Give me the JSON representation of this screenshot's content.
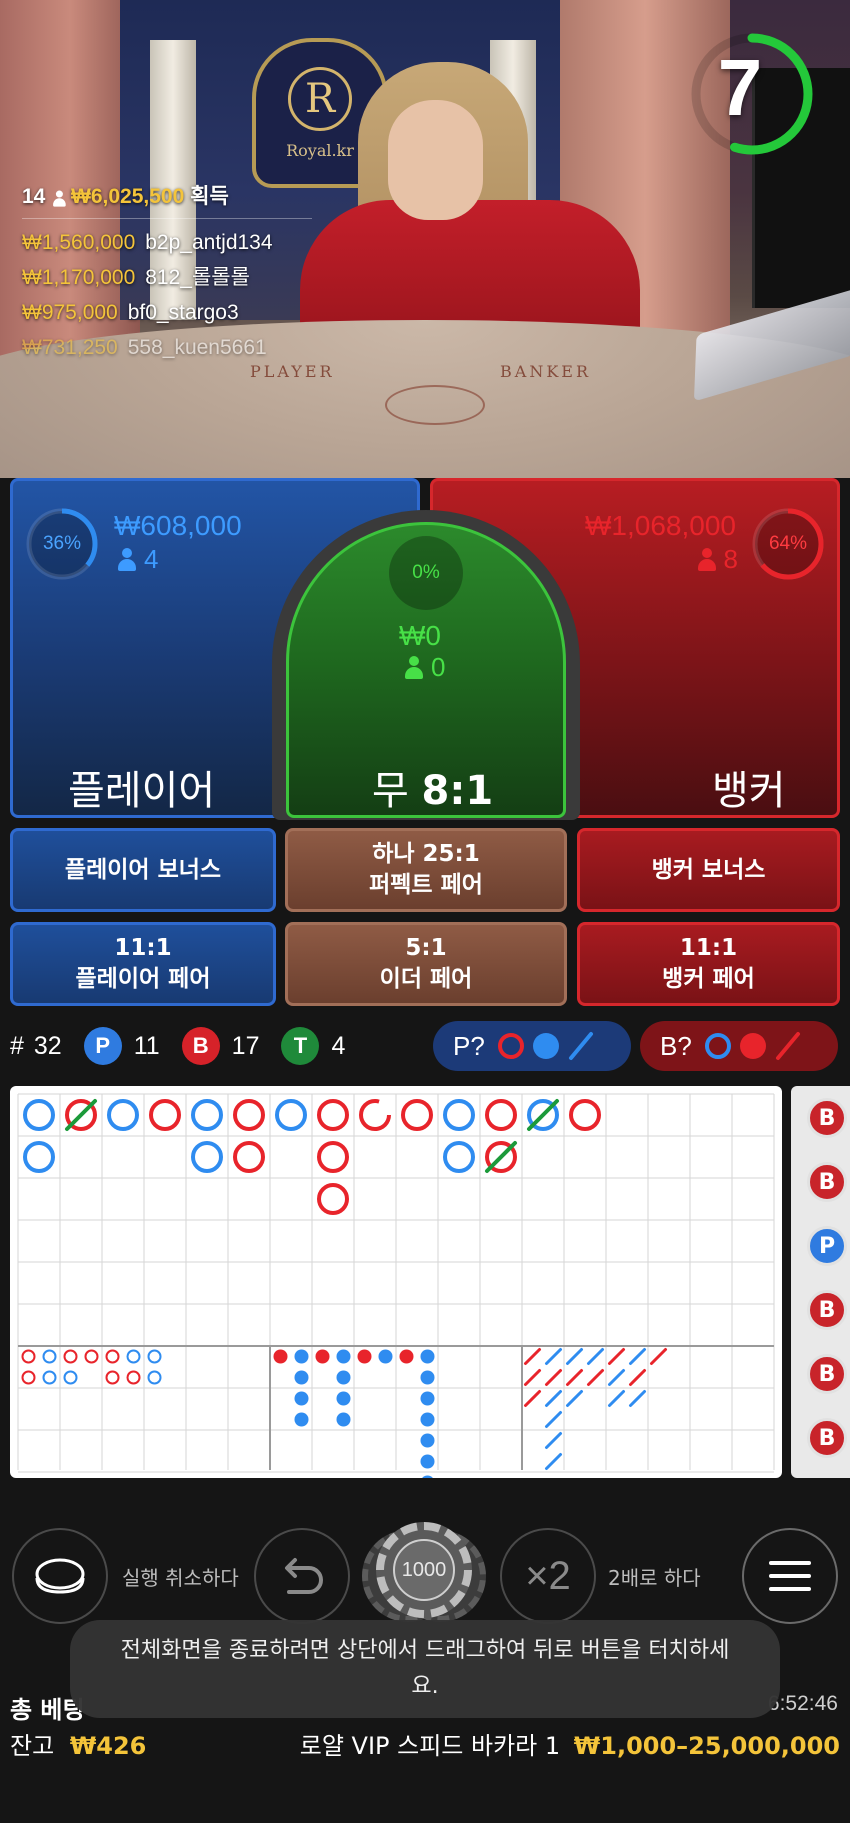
{
  "timer": {
    "seconds": "7",
    "progress": 0.55,
    "color": "#24c83a"
  },
  "winners": {
    "count": "14",
    "total": "₩6,025,500",
    "suffix": "획득",
    "list": [
      {
        "amount": "₩1,560,000",
        "user": "b2p_antjd134"
      },
      {
        "amount": "₩1,170,000",
        "user": "812_롤롤롤"
      },
      {
        "amount": "₩975,000",
        "user": "bf0_stargo3"
      },
      {
        "amount": "₩731,250",
        "user": "558_kuen5661"
      }
    ]
  },
  "table_labels": {
    "player": "PLAYER",
    "banker": "BANKER",
    "crest_letter": "R",
    "crest_brand": "Royal.kr"
  },
  "player": {
    "percent": "36%",
    "percent_value": 0.36,
    "amount": "₩608,000",
    "players": "4",
    "label": "플레이어",
    "color": "#2f8cf0"
  },
  "banker": {
    "percent": "64%",
    "percent_value": 0.64,
    "amount": "₩1,068,000",
    "players": "8",
    "label": "뱅커",
    "color": "#e8242b"
  },
  "tie": {
    "percent": "0%",
    "amount": "₩0",
    "players": "0",
    "label_prefix": "무",
    "label_odds": "8:1",
    "color": "#3ce03c"
  },
  "side_bets": {
    "player_bonus": "플레이어 보너스",
    "perfect_pair_line1": "하나 25:1",
    "perfect_pair_line2": "퍼펙트 페어",
    "banker_bonus": "뱅커 보너스",
    "player_pair_line1": "11:1",
    "player_pair_line2": "플레이어 페어",
    "either_pair_line1": "5:1",
    "either_pair_line2": "이더 페어",
    "banker_pair_line1": "11:1",
    "banker_pair_line2": "뱅커 페어"
  },
  "stats": {
    "round_label": "#",
    "round": "32",
    "p_letter": "P",
    "p_count": "11",
    "b_letter": "B",
    "b_count": "17",
    "t_letter": "T",
    "t_count": "4",
    "p_predict": "P?",
    "b_predict": "B?"
  },
  "roadmap": {
    "big_road": [
      [
        "P",
        "P"
      ],
      [
        "BT"
      ],
      [
        "P"
      ],
      [
        "B"
      ],
      [
        "P",
        "P"
      ],
      [
        "B",
        "B"
      ],
      [
        "P"
      ],
      [
        "B",
        "B",
        "B"
      ],
      [
        "Bp"
      ],
      [
        "B"
      ],
      [
        "P",
        "P"
      ],
      [
        "B",
        "BT"
      ],
      [
        "PT"
      ],
      [
        "B"
      ]
    ],
    "big_eye": [
      [
        "B",
        "B"
      ],
      [
        "P",
        "P"
      ],
      [
        "B",
        "P"
      ],
      [
        "B"
      ],
      [
        "B",
        "B"
      ],
      [
        "P",
        "B"
      ],
      [
        "P",
        "P"
      ],
      [],
      [],
      []
    ],
    "small_road": [
      [
        "R"
      ],
      [
        "B",
        "B",
        "B",
        "B"
      ],
      [
        "R"
      ],
      [
        "B",
        "B",
        "B",
        "B"
      ],
      [
        "R"
      ],
      [
        "B"
      ],
      [
        "R"
      ],
      [
        "B",
        "B",
        "B",
        "B",
        "B",
        "B",
        "B"
      ]
    ],
    "cockroach": [
      [
        "R",
        "R",
        "R"
      ],
      [
        "B",
        "R",
        "B",
        "B",
        "B",
        "B"
      ],
      [
        "B",
        "R",
        "B"
      ],
      [
        "B",
        "R"
      ],
      [
        "R",
        "B",
        "B"
      ],
      [
        "B",
        "R",
        "B"
      ],
      [
        "R"
      ]
    ],
    "bead_letters": [
      "B",
      "B",
      "P",
      "B",
      "B",
      "B"
    ]
  },
  "controls": {
    "undo_label": "실행 취소하다",
    "chip_value": "1000",
    "double_symbol": "×2",
    "double_label": "2배로 하다"
  },
  "toast": "전체화면을 종료하려면 상단에서 드래그하여 뒤로 버튼을 터치하세요.",
  "footer": {
    "total_bet_label": "총 베팅",
    "clock": "6:52:46",
    "balance_label": "잔고",
    "balance": "₩426",
    "table_name": "로얄 VIP 스피드 바카라 1",
    "limits": "₩1,000–25,000,000"
  }
}
